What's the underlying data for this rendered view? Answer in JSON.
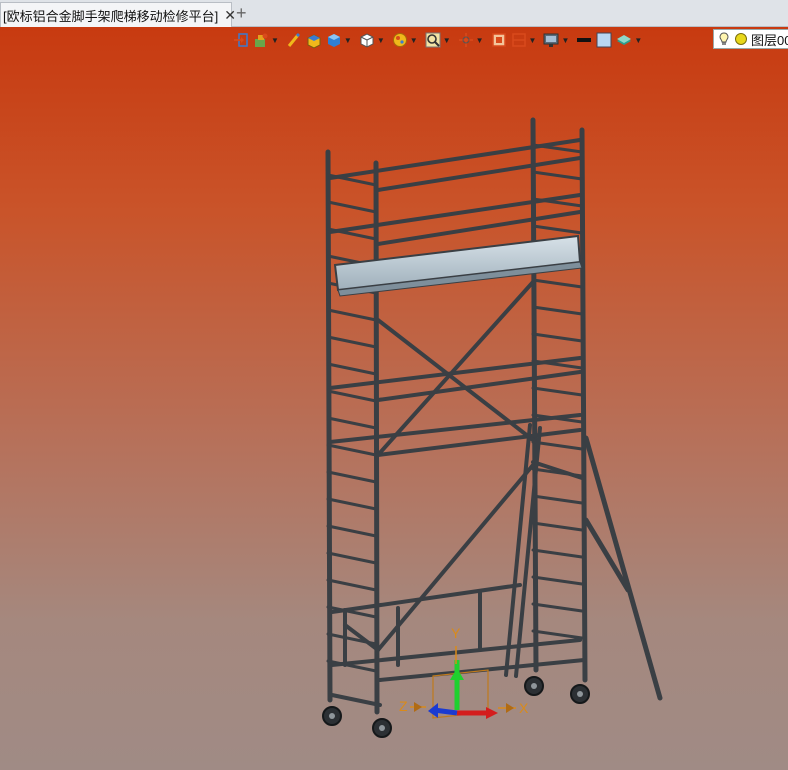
{
  "tab": {
    "title": "[欧标铝合金脚手架爬梯移动检修平台]",
    "close_glyph": "✕",
    "add_glyph": "+"
  },
  "toolbar": {
    "buttons": [
      {
        "icon": "exit-view-icon",
        "dropdown": false
      },
      {
        "icon": "render-style-icon",
        "dropdown": true
      },
      {
        "icon": "brush-icon",
        "dropdown": false
      },
      {
        "icon": "box-edges-icon",
        "dropdown": false
      },
      {
        "icon": "solid-shaded-icon",
        "dropdown": true
      },
      {
        "icon": "wireframe-cube-icon",
        "dropdown": true
      },
      {
        "icon": "appearance-ball-icon",
        "dropdown": true
      },
      {
        "icon": "zoom-icon",
        "dropdown": true
      },
      {
        "icon": "crosshair-icon",
        "dropdown": true
      },
      {
        "icon": "section-view-icon",
        "dropdown": false
      },
      {
        "icon": "clip-plane-icon",
        "dropdown": true
      },
      {
        "icon": "display-monitor-icon",
        "dropdown": true
      },
      {
        "icon": "line-color-icon",
        "dropdown": false
      },
      {
        "icon": "background-color-icon",
        "dropdown": false
      },
      {
        "icon": "layer-stack-icon",
        "dropdown": true
      }
    ],
    "layer": {
      "label": "图层00",
      "icons": [
        "bulb-icon",
        "sun-icon"
      ]
    }
  },
  "triad": {
    "x_label": "X",
    "y_label": "Y",
    "z_label": "Z"
  },
  "colors": {
    "viewport_top": "#c83a10",
    "viewport_bottom": "#a08b85",
    "scaffold_tube": "#3a3f44",
    "platform": "#b9c6cf"
  }
}
